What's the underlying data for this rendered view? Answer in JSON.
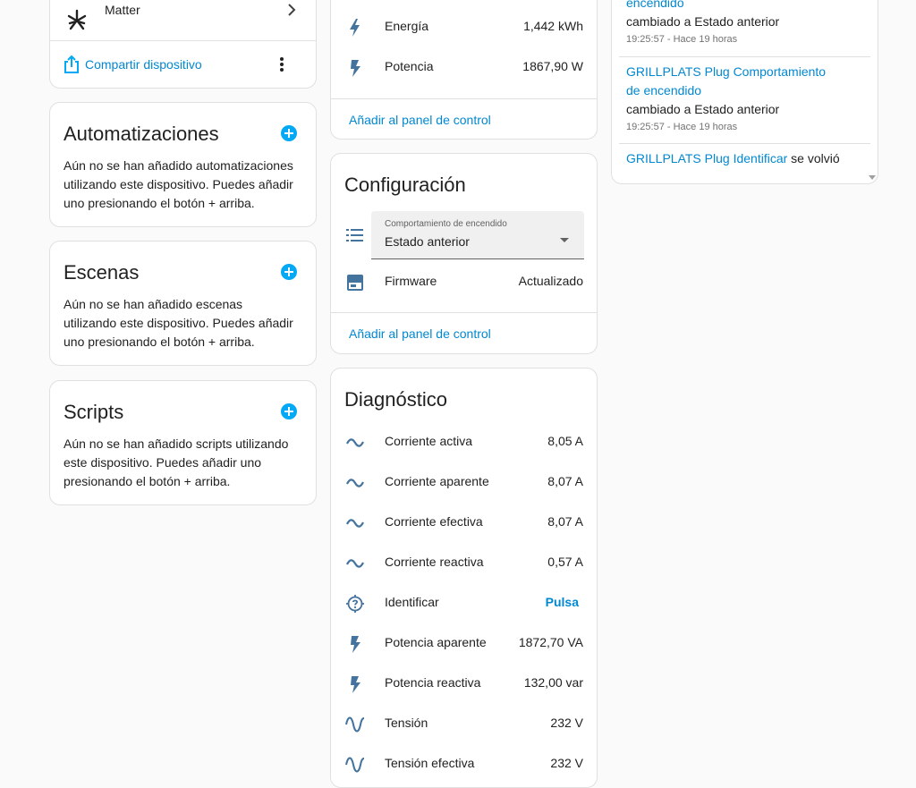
{
  "device_card": {
    "integration_label": "Matter",
    "share_label": "Compartir dispositivo"
  },
  "automations": {
    "title": "Automatizaciones",
    "text": "Aún no se han añadido automatizaciones utilizando este dispositivo. Puedes añadir uno presionando el botón + arriba."
  },
  "scenes": {
    "title": "Escenas",
    "text": "Aún no se han añadido escenas utilizando este dispositivo. Puedes añadir uno presionando el botón + arriba."
  },
  "scripts": {
    "title": "Scripts",
    "text": "Aún no se han añadido scripts utilizando este dispositivo. Puedes añadir uno presionando el botón + arriba."
  },
  "sensors": {
    "rows": [
      {
        "label": "Energía",
        "value": "1,442 kWh",
        "icon": "lightning-bolt-icon"
      },
      {
        "label": "Potencia",
        "value": "1867,90 W",
        "icon": "flash-icon"
      }
    ],
    "add_label": "Añadir al panel de control"
  },
  "configuration": {
    "title": "Configuración",
    "select_label": "Comportamiento de encendido",
    "select_value": "Estado anterior",
    "firmware_label": "Firmware",
    "firmware_value": "Actualizado",
    "add_label": "Añadir al panel de control"
  },
  "diagnostics": {
    "title": "Diagnóstico",
    "rows": [
      {
        "label": "Corriente activa",
        "value": "8,05 A",
        "icon": "current-ac-icon"
      },
      {
        "label": "Corriente aparente",
        "value": "8,07 A",
        "icon": "current-ac-icon"
      },
      {
        "label": "Corriente efectiva",
        "value": "8,07 A",
        "icon": "current-ac-icon"
      },
      {
        "label": "Corriente reactiva",
        "value": "0,57 A",
        "icon": "current-ac-icon"
      },
      {
        "label": "Identificar",
        "value": "Pulsa",
        "icon": "crosshairs-question-icon"
      },
      {
        "label": "Potencia aparente",
        "value": "1872,70 VA",
        "icon": "flash-icon"
      },
      {
        "label": "Potencia reactiva",
        "value": "132,00 var",
        "icon": "flash-icon"
      },
      {
        "label": "Tensión",
        "value": "232 V",
        "icon": "sine-wave-icon"
      },
      {
        "label": "Tensión efectiva",
        "value": "232 V",
        "icon": "sine-wave-icon"
      }
    ]
  },
  "logbook": {
    "entries": [
      {
        "link": "encendido",
        "text": "cambiado a Estado anterior",
        "time": "19:25:57 - Hace 19 horas"
      },
      {
        "link": "GRILLPLATS Plug Comportamiento de encendido",
        "text": "cambiado a Estado anterior",
        "time": "19:25:57 - Hace 19 horas"
      },
      {
        "link": "GRILLPLATS Plug Identificar",
        "text": "se volvió"
      }
    ]
  },
  "colors": {
    "accent": "#03a9f4",
    "link": "#0288d1",
    "icon": "#44739e"
  }
}
